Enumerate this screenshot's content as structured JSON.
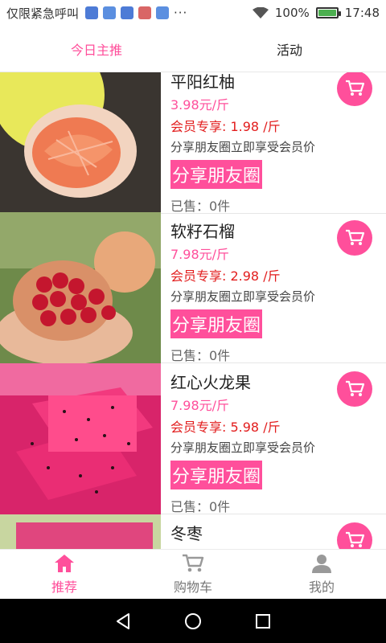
{
  "status_bar": {
    "carrier": "仅限紧急呼叫",
    "battery_percent": "100%",
    "battery_level": 1.0,
    "time": "17:48",
    "dots": "···"
  },
  "tabs": [
    {
      "label": "今日主推",
      "active": true
    },
    {
      "label": "活动",
      "active": false
    }
  ],
  "products": [
    {
      "name": "平阳红柚",
      "price": "3.98元/斤",
      "member_price": "会员专享: 1.98 /斤",
      "tip": "分享朋友圈立即享受会员价",
      "share_label": "分享朋友圈",
      "sold": "已售：0件"
    },
    {
      "name": "软籽石榴",
      "price": "7.98元/斤",
      "member_price": "会员专享: 2.98 /斤",
      "tip": "分享朋友圈立即享受会员价",
      "share_label": "分享朋友圈",
      "sold": "已售：0件"
    },
    {
      "name": "红心火龙果",
      "price": "7.98元/斤",
      "member_price": "会员专享: 5.98 /斤",
      "tip": "分享朋友圈立即享受会员价",
      "share_label": "分享朋友圈",
      "sold": "已售：0件"
    },
    {
      "name": "冬枣"
    }
  ],
  "bottom_nav": [
    {
      "label": "推荐",
      "icon": "home-icon",
      "active": true
    },
    {
      "label": "购物车",
      "icon": "cart-icon",
      "active": false
    },
    {
      "label": "我的",
      "icon": "user-icon",
      "active": false
    }
  ],
  "colors": {
    "accent": "#ff4f9b",
    "member_red": "#e21d1d"
  }
}
